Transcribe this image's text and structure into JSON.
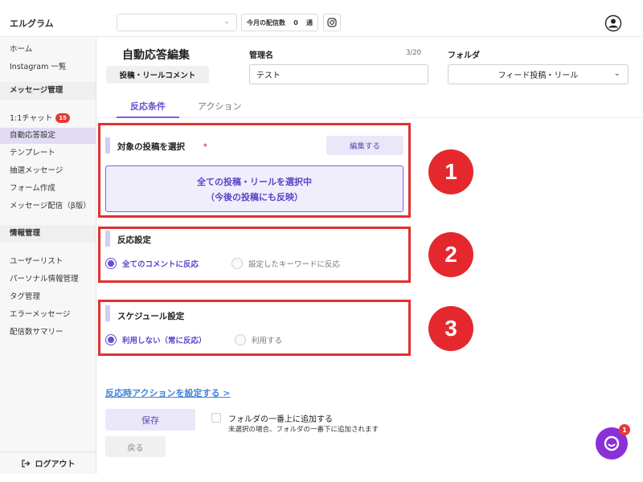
{
  "app": {
    "brand": "エルグラム"
  },
  "topbar": {
    "account_select_value": "",
    "delivery_label": "今月の配信数",
    "delivery_count": "0",
    "delivery_unit": "通"
  },
  "sidebar": {
    "top_links": [
      "ホーム",
      "Instagram 一覧"
    ],
    "sections": [
      {
        "title": "メッセージ管理",
        "items": [
          {
            "label": "1:1チャット",
            "badge": "15"
          },
          {
            "label": "自動応答設定",
            "active": true
          },
          {
            "label": "テンプレート"
          },
          {
            "label": "抽選メッセージ"
          },
          {
            "label": "フォーム作成"
          },
          {
            "label": "メッセージ配信（β版）"
          }
        ]
      },
      {
        "title": "情報管理",
        "items": [
          {
            "label": "ユーザーリスト"
          },
          {
            "label": "パーソナル情報管理"
          },
          {
            "label": "タグ管理"
          },
          {
            "label": "エラーメッセージ"
          },
          {
            "label": "配信数サマリー"
          }
        ]
      }
    ],
    "logout_label": "ログアウト"
  },
  "header": {
    "title": "自動応答編集",
    "type_chip": "投稿・リールコメント",
    "name_label": "管理名",
    "name_counter": "3/20",
    "name_value": "テスト",
    "folder_label": "フォルダ",
    "folder_value": "フィード投稿・リール"
  },
  "tabs": [
    {
      "label": "反応条件",
      "active": true
    },
    {
      "label": "アクション",
      "active": false
    }
  ],
  "sections": {
    "target": {
      "number": "1",
      "title": "対象の投稿を選択",
      "required_mark": "*",
      "edit_button": "編集する",
      "selection_line1": "全ての投稿・リールを選択中",
      "selection_line2": "（今後の投稿にも反映）"
    },
    "reaction": {
      "number": "2",
      "title": "反応設定",
      "options": [
        {
          "label": "全てのコメントに反応",
          "checked": true
        },
        {
          "label": "設定したキーワードに反応",
          "checked": false
        }
      ]
    },
    "schedule": {
      "number": "3",
      "title": "スケジュール設定",
      "options": [
        {
          "label": "利用しない（常に反応）",
          "checked": true
        },
        {
          "label": "利用する",
          "checked": false
        }
      ]
    }
  },
  "footer": {
    "action_link": "反応時アクションを設定する >",
    "save_button": "保存",
    "back_button": "戻る",
    "checkbox_label": "フォルダの一番上に追加する",
    "checkbox_note": "未選択の場合、フォルダの一番下に追加されます"
  },
  "chat_widget": {
    "badge": "1"
  },
  "colors": {
    "accent": "#6a4fd0",
    "highlight_red": "#e23030",
    "link_blue": "#3f83d8",
    "chat_purple": "#8b2fd9"
  }
}
